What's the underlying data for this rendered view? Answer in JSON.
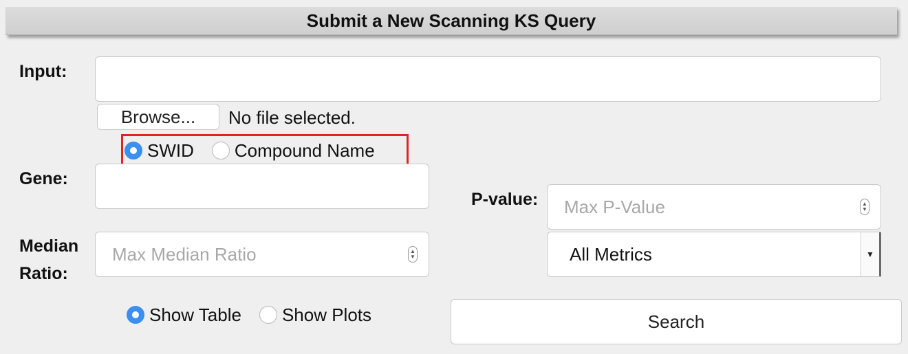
{
  "header": {
    "title": "Submit a New Scanning KS Query"
  },
  "form": {
    "input_label": "Input:",
    "input_value": "",
    "browse_label": "Browse...",
    "file_status": "No file selected.",
    "id_type_options": [
      {
        "label": "SWID",
        "selected": true
      },
      {
        "label": "Compound Name",
        "selected": false
      }
    ],
    "gene_label": "Gene:",
    "gene_value": "",
    "median_label_line1": "Median",
    "median_label_line2": "Ratio:",
    "median_placeholder": "Max Median Ratio",
    "pvalue_label": "P-value:",
    "pvalue_placeholder": "Max P-Value",
    "metrics_selected": "All Metrics",
    "display_options": [
      {
        "label": "Show Table",
        "selected": true
      },
      {
        "label": "Show Plots",
        "selected": false
      }
    ],
    "search_label": "Search"
  },
  "colors": {
    "radio_selected": "#3b8fef",
    "highlight_border": "#e02424"
  }
}
